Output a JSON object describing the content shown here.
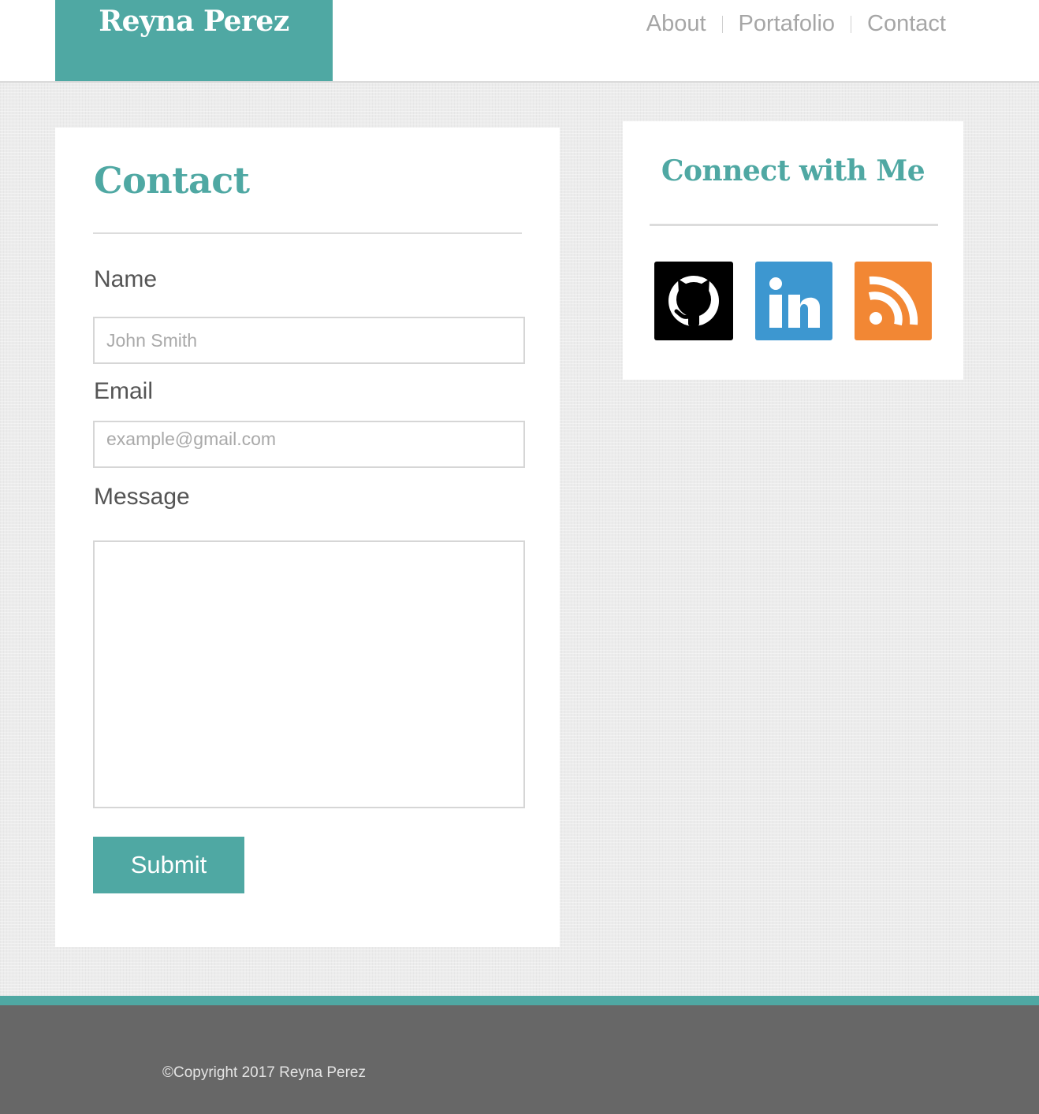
{
  "header": {
    "brand": "Reyna Perez",
    "nav": [
      {
        "label": "About"
      },
      {
        "label": "Portafolio"
      },
      {
        "label": "Contact"
      }
    ]
  },
  "contact": {
    "title": "Contact",
    "name_label": "Name",
    "name_placeholder": "John Smith",
    "email_label": "Email",
    "email_placeholder": "example@gmail.com",
    "message_label": "Message",
    "submit_label": "Submit"
  },
  "connect": {
    "title": "Connect with Me",
    "icons": [
      {
        "name": "github-icon",
        "color": "#000000"
      },
      {
        "name": "linkedin-icon",
        "color": "#3d97d0"
      },
      {
        "name": "rss-icon",
        "color": "#f28734"
      }
    ]
  },
  "footer": {
    "copyright": "©Copyright 2017 Reyna Perez"
  },
  "colors": {
    "accent": "#4fa8a3",
    "footer_bg": "#676767",
    "page_bg": "#ececec"
  }
}
